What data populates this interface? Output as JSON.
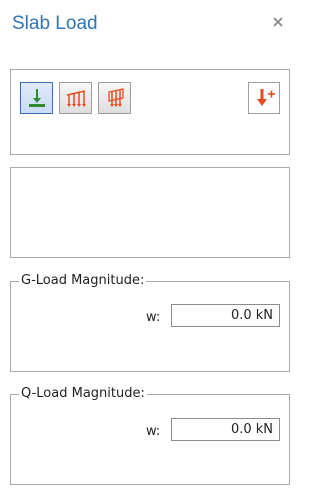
{
  "panel": {
    "title": "Slab Load",
    "close_glyph": "×"
  },
  "toolbar": {
    "buttons": [
      {
        "icon": "point-load-icon",
        "selected": true
      },
      {
        "icon": "distributed-load-icon",
        "selected": false
      },
      {
        "icon": "area-load-icon",
        "selected": false
      },
      {
        "icon": "add-load-icon",
        "selected": false
      }
    ]
  },
  "g_load": {
    "legend": "G-Load Magnitude:",
    "w_label": "w:",
    "value": "0.0 kN"
  },
  "q_load": {
    "legend": "Q-Load Magnitude:",
    "w_label": "w:",
    "value": "0.0 kN"
  },
  "colors": {
    "title": "#2e75b6",
    "icon_green": "#2e8b2e",
    "icon_red": "#e84a1f"
  }
}
